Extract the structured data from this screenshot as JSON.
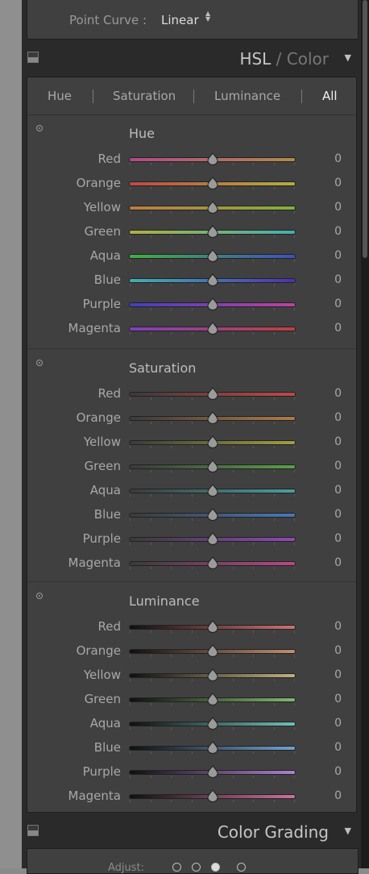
{
  "point_curve": {
    "label": "Point Curve :",
    "value": "Linear",
    "arrows": "▴▾"
  },
  "hsl_header": {
    "title_main": "HSL",
    "title_sep": " / ",
    "title_alt": "Color",
    "collapse_icon": "triangle-down-icon"
  },
  "tabs": [
    {
      "label": "Hue",
      "active": false
    },
    {
      "label": "Saturation",
      "active": false
    },
    {
      "label": "Luminance",
      "active": false
    },
    {
      "label": "All",
      "active": true
    }
  ],
  "sections": [
    {
      "title": "Hue",
      "id": "hue",
      "rows": [
        {
          "label": "Red",
          "value": "0",
          "from": "#b04a8a",
          "to": "#b08a4a"
        },
        {
          "label": "Orange",
          "value": "0",
          "from": "#c04848",
          "to": "#b0b040"
        },
        {
          "label": "Yellow",
          "value": "0",
          "from": "#c07a40",
          "to": "#80b040"
        },
        {
          "label": "Green",
          "value": "0",
          "from": "#b0b040",
          "to": "#40b0b0"
        },
        {
          "label": "Aqua",
          "value": "0",
          "from": "#40b040",
          "to": "#4050c0"
        },
        {
          "label": "Blue",
          "value": "0",
          "from": "#40b0b0",
          "to": "#5030b0"
        },
        {
          "label": "Purple",
          "value": "0",
          "from": "#4040c0",
          "to": "#c040a0"
        },
        {
          "label": "Magenta",
          "value": "0",
          "from": "#8040c0",
          "to": "#c04040"
        }
      ]
    },
    {
      "title": "Saturation",
      "id": "saturation",
      "rows": [
        {
          "label": "Red",
          "value": "0",
          "from": "#3a3a3a",
          "to": "#c04848"
        },
        {
          "label": "Orange",
          "value": "0",
          "from": "#3a3a3a",
          "to": "#b07a48"
        },
        {
          "label": "Yellow",
          "value": "0",
          "from": "#3a3a3a",
          "to": "#a0a040"
        },
        {
          "label": "Green",
          "value": "0",
          "from": "#3a3a3a",
          "to": "#58a048"
        },
        {
          "label": "Aqua",
          "value": "0",
          "from": "#3a3a3a",
          "to": "#48a0a0"
        },
        {
          "label": "Blue",
          "value": "0",
          "from": "#3a3a3a",
          "to": "#4878b8"
        },
        {
          "label": "Purple",
          "value": "0",
          "from": "#3a3a3a",
          "to": "#9048b8"
        },
        {
          "label": "Magenta",
          "value": "0",
          "from": "#3a3a3a",
          "to": "#b8488a"
        }
      ]
    },
    {
      "title": "Luminance",
      "id": "luminance",
      "rows": [
        {
          "label": "Red",
          "value": "0",
          "from": "#101010",
          "to": "#d07070"
        },
        {
          "label": "Orange",
          "value": "0",
          "from": "#101010",
          "to": "#c09070"
        },
        {
          "label": "Yellow",
          "value": "0",
          "from": "#101010",
          "to": "#c0b080"
        },
        {
          "label": "Green",
          "value": "0",
          "from": "#101010",
          "to": "#80b870"
        },
        {
          "label": "Aqua",
          "value": "0",
          "from": "#101010",
          "to": "#70c0b8"
        },
        {
          "label": "Blue",
          "value": "0",
          "from": "#101010",
          "to": "#70a0d0"
        },
        {
          "label": "Purple",
          "value": "0",
          "from": "#101010",
          "to": "#b080d0"
        },
        {
          "label": "Magenta",
          "value": "0",
          "from": "#101010",
          "to": "#d070a0"
        }
      ]
    }
  ],
  "color_grading": {
    "title": "Color Grading",
    "adjust_label": "Adjust:",
    "collapse_icon": "triangle-down-icon"
  }
}
